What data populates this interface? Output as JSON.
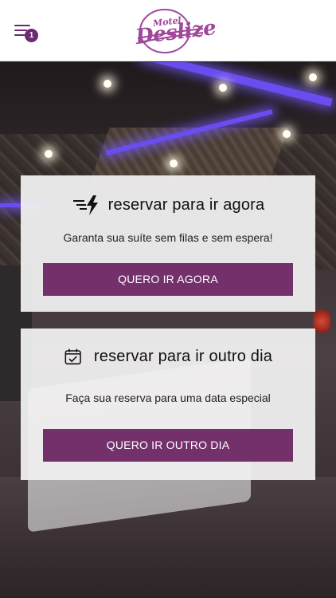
{
  "header": {
    "menu_icon": "hamburger-menu-icon",
    "menu_badge": "1",
    "logo_small": "Motel",
    "logo_main": "Deslize"
  },
  "cards": [
    {
      "icon": "fast-lightning-icon",
      "title": "reservar para ir agora",
      "subtitle": "Garanta sua suíte sem filas e sem espera!",
      "button": "QUERO IR AGORA"
    },
    {
      "icon": "calendar-check-icon",
      "title": "reservar para ir outro dia",
      "subtitle": "Faça sua reserva para uma data especial",
      "button": "QUERO IR OUTRO DIA"
    }
  ],
  "colors": {
    "brand_purple": "#74306b",
    "logo_purple": "#a0469b"
  }
}
